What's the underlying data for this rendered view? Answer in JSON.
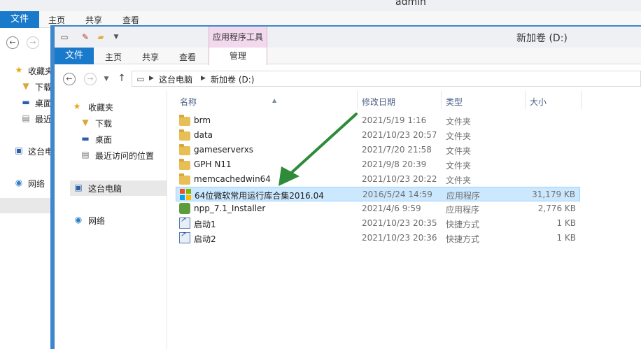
{
  "back_window": {
    "title": "admin",
    "file_tab": "文件",
    "tabs": [
      "主页",
      "共享",
      "查看"
    ],
    "nav_items": [
      "收藏夹",
      "下载",
      "桌面",
      "最近",
      "这台电",
      "网络"
    ]
  },
  "window": {
    "title": "新加卷 (D:)",
    "context_tool_label": "应用程序工具",
    "file_tab": "文件",
    "tabs": [
      "主页",
      "共享",
      "查看"
    ],
    "manage_tab": "管理"
  },
  "address": {
    "breadcrumb": [
      "这台电脑",
      "新加卷 (D:)"
    ]
  },
  "nav_pane": {
    "favorites": "收藏夹",
    "downloads": "下载",
    "desktop": "桌面",
    "recent": "最近访问的位置",
    "this_pc": "这台电脑",
    "network": "网络"
  },
  "columns": {
    "name": "名称",
    "date": "修改日期",
    "type": "类型",
    "size": "大小"
  },
  "files": [
    {
      "name": "brm",
      "date": "2021/5/19 1:16",
      "type": "文件夹",
      "size": "",
      "icon": "folder-icon"
    },
    {
      "name": "data",
      "date": "2021/10/23 20:57",
      "type": "文件夹",
      "size": "",
      "icon": "folder-icon"
    },
    {
      "name": "gameserverxs",
      "date": "2021/7/20 21:58",
      "type": "文件夹",
      "size": "",
      "icon": "folder-icon"
    },
    {
      "name": "GPH N11",
      "date": "2021/9/8 20:39",
      "type": "文件夹",
      "size": "",
      "icon": "folder-icon"
    },
    {
      "name": "memcachedwin64",
      "date": "2021/10/23 20:22",
      "type": "文件夹",
      "size": "",
      "icon": "folder-icon"
    },
    {
      "name": "64位微软常用运行库合集2016.04",
      "date": "2016/5/24 14:59",
      "type": "应用程序",
      "size": "31,179 KB",
      "icon": "windows-logo-icon"
    },
    {
      "name": "npp_7.1_Installer",
      "date": "2021/4/6 9:59",
      "type": "应用程序",
      "size": "2,776 KB",
      "icon": "installer-icon"
    },
    {
      "name": "启动1",
      "date": "2021/10/23 20:35",
      "type": "快捷方式",
      "size": "1 KB",
      "icon": "shortcut-icon"
    },
    {
      "name": "启动2",
      "date": "2021/10/23 20:36",
      "type": "快捷方式",
      "size": "1 KB",
      "icon": "shortcut-icon"
    }
  ],
  "selected_index": 5,
  "colors": {
    "accent": "#1979ca",
    "selection": "#cce8ff",
    "context_tool": "#f3d9ee",
    "annotation_arrow": "#2e8b3a"
  }
}
